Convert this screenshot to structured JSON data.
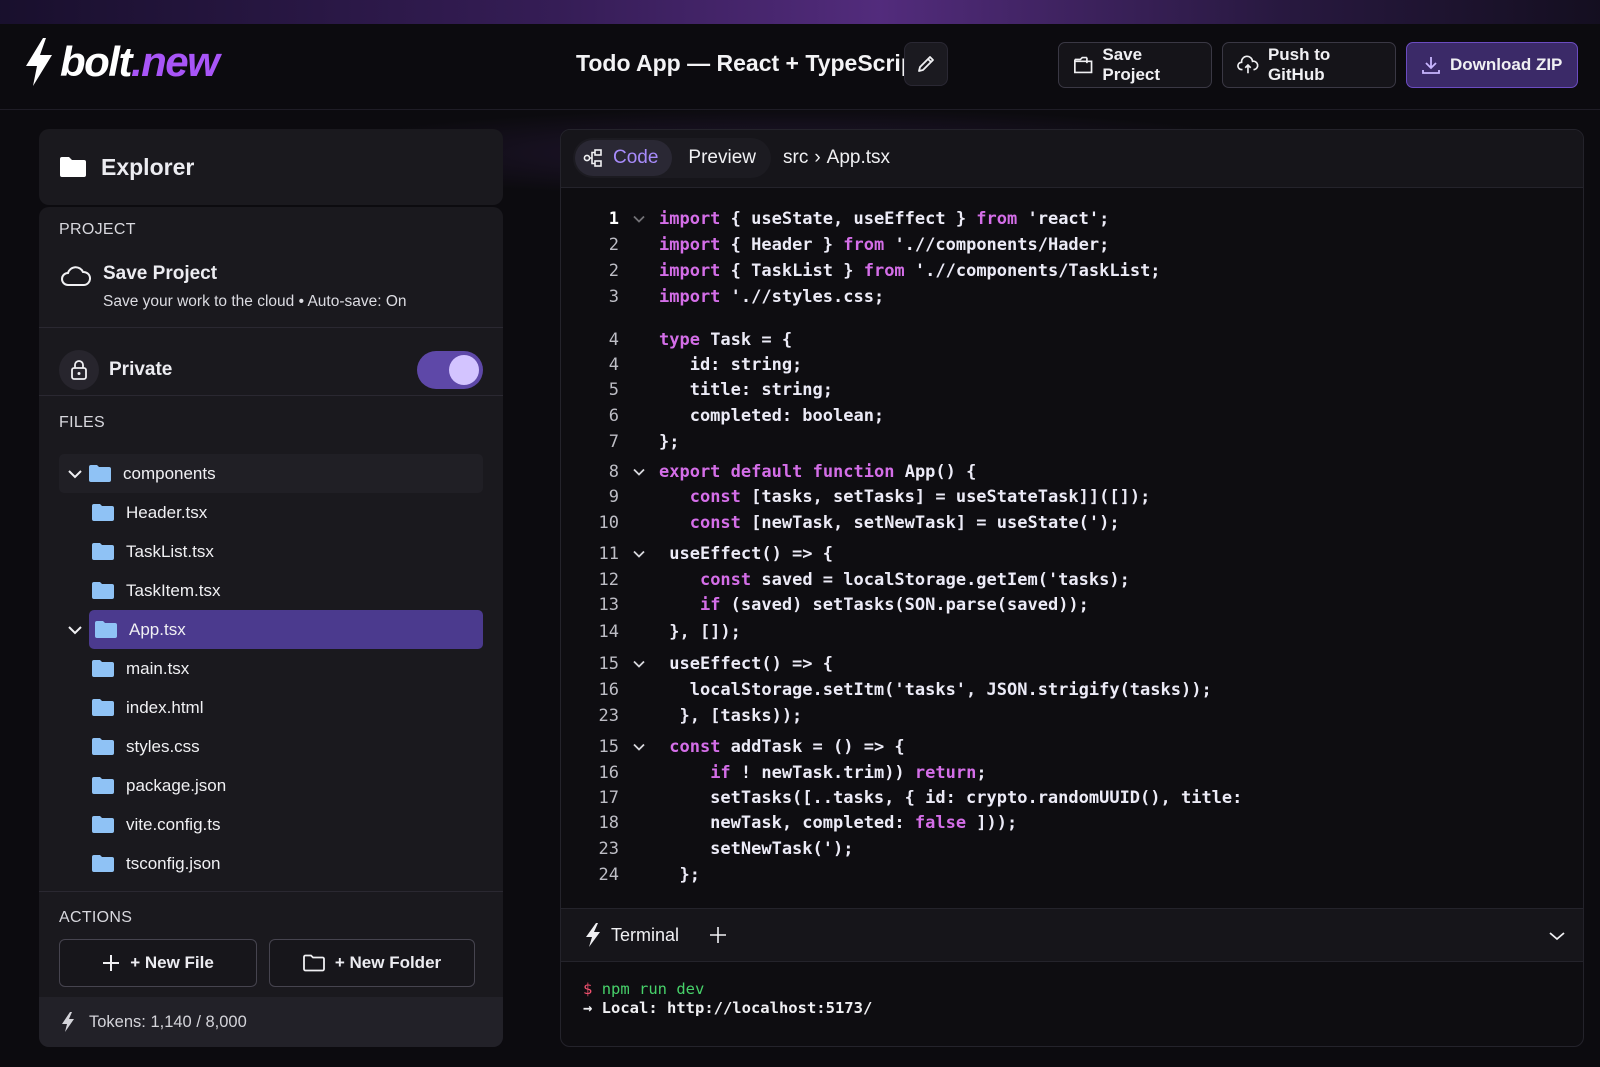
{
  "header": {
    "logo_main": "bolt",
    "logo_accent": ".new",
    "project_title": "Todo App — React + TypeScript",
    "buttons": {
      "save": "Save Project",
      "push": "Push to GitHub",
      "download": "Download ZIP"
    }
  },
  "sidebar": {
    "explorer_title": "Explorer",
    "project_label": "PROJECT",
    "save_title": "Save Project",
    "save_subtitle": "Save your work to the cloud • Auto-save: On",
    "private_label": "Private",
    "private_on": true,
    "files_label": "FILES",
    "files": [
      {
        "name": "components",
        "expanded": true
      },
      {
        "name": "Header.tsx"
      },
      {
        "name": "TaskList.tsx"
      },
      {
        "name": "TaskItem.tsx"
      },
      {
        "name": "App.tsx",
        "selected": true
      },
      {
        "name": "main.tsx"
      },
      {
        "name": "index.html"
      },
      {
        "name": "styles.css"
      },
      {
        "name": "package.json"
      },
      {
        "name": "vite.config.ts"
      },
      {
        "name": "tsconfig.json"
      }
    ],
    "actions_label": "ACTIONS",
    "new_file": "+ New File",
    "new_folder": "+ New Folder",
    "tokens": "Tokens: 1,140 / 8,000"
  },
  "editor": {
    "tab_code": "Code",
    "tab_preview": "Preview",
    "breadcrumb_dir": "src",
    "breadcrumb_sep": "›",
    "breadcrumb_file": "App.tsx",
    "lines": [
      {
        "n": "1",
        "fold": true,
        "code": "import { useState, useEffect } from 'react';"
      },
      {
        "n": "2",
        "code": "import { Header } from './/components/Hader;"
      },
      {
        "n": "2",
        "code": "import { TaskList } from './/components/TaskList;"
      },
      {
        "n": "3",
        "code": "import './/styles.css;"
      },
      {
        "n": "4",
        "code": "type Task = {"
      },
      {
        "n": "4",
        "code": "   id: string;"
      },
      {
        "n": "5",
        "code": "   title: string;"
      },
      {
        "n": "6",
        "code": "   completed: boolean;"
      },
      {
        "n": "7",
        "code": "};"
      },
      {
        "n": "8",
        "fold": true,
        "code": "export default function App() {"
      },
      {
        "n": "9",
        "code": "   const [tasks, setTasks] = useStateTask]]([]);"
      },
      {
        "n": "10",
        "code": "   const [newTask, setNewTask] = useState(');"
      },
      {
        "n": "11",
        "fold": true,
        "code": " useEffect() => {"
      },
      {
        "n": "12",
        "code": "    const saved = localStorage.getIem('tasks);"
      },
      {
        "n": "13",
        "code": "    if (saved) setTasks(SON.parse(saved));"
      },
      {
        "n": "14",
        "code": " }, []);"
      },
      {
        "n": "15",
        "fold": true,
        "code": " useEffect() => {"
      },
      {
        "n": "16",
        "code": "   localStorage.setItm('tasks', JSON.strigify(tasks));"
      },
      {
        "n": "23",
        "code": "  }, [tasks));"
      },
      {
        "n": "15",
        "fold": true,
        "code": " const addTask = () => {"
      },
      {
        "n": "16",
        "code": "     if ! newTask.trim)) return;"
      },
      {
        "n": "17",
        "code": "     setTasks([..tasks, { id: crypto.randomUUID(), title:"
      },
      {
        "n": "18",
        "code": "     newTask, completed: false ]));"
      },
      {
        "n": "23",
        "code": "     setNewTask(');"
      },
      {
        "n": "24",
        "code": "  };"
      }
    ]
  },
  "terminal": {
    "label": "Terminal",
    "prompt": "$",
    "command": "npm run dev",
    "output": "→ Local: http://localhost:5173/"
  },
  "colors": {
    "accent": "#a855f7",
    "selected": "#4b3a8e",
    "keyword": "#d46ee8",
    "prompt_green": "#47d16a"
  }
}
